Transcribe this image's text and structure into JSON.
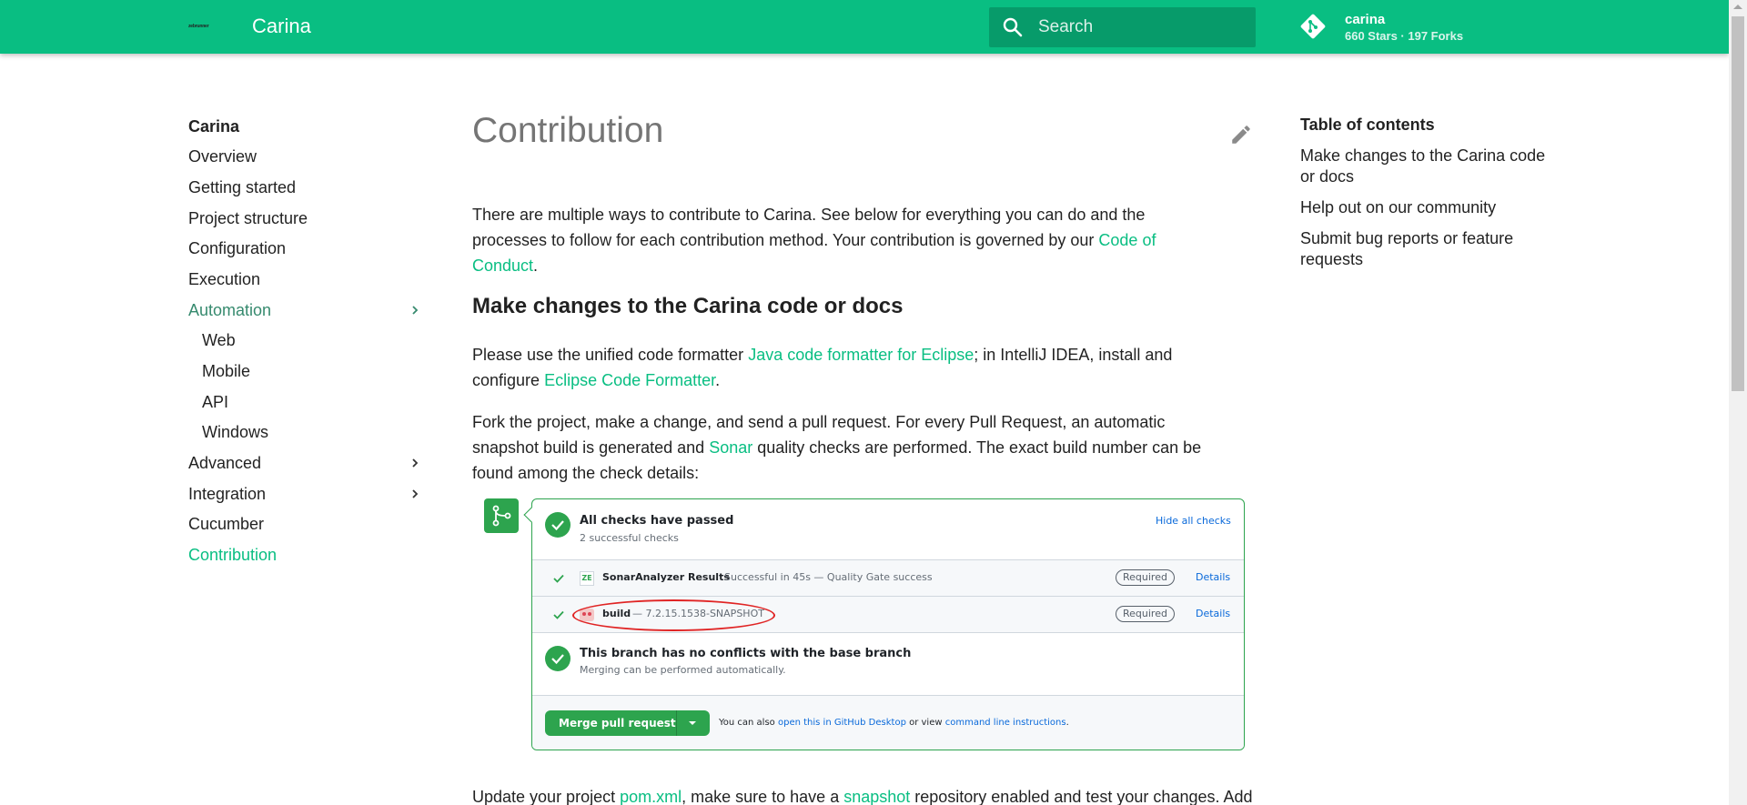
{
  "header": {
    "logo_text": "zebrunner",
    "site_title": "Carina",
    "search_placeholder": "Search",
    "repo_name": "carina",
    "repo_stats": "660 Stars · 197 Forks"
  },
  "nav": {
    "title": "Carina",
    "items": [
      {
        "label": "Overview"
      },
      {
        "label": "Getting started"
      },
      {
        "label": "Project structure"
      },
      {
        "label": "Configuration"
      },
      {
        "label": "Execution"
      },
      {
        "label": "Automation"
      },
      {
        "label": "Web"
      },
      {
        "label": "Mobile"
      },
      {
        "label": "API"
      },
      {
        "label": "Windows"
      },
      {
        "label": "Advanced"
      },
      {
        "label": "Integration"
      },
      {
        "label": "Cucumber"
      },
      {
        "label": "Contribution"
      }
    ]
  },
  "main": {
    "title": "Contribution",
    "intro": {
      "text": "There are multiple ways to contribute to Carina. See below for everything you can do and the processes to follow for each contribution method. Your contribution is governed by our ",
      "link": "Code of Conduct",
      "end": "."
    },
    "h2": "Make changes to the Carina code or docs",
    "p1": {
      "a": "Please use the unified code formatter ",
      "link1": "Java code formatter for Eclipse",
      "b": "; in IntelliJ IDEA, install and configure ",
      "link2": "Eclipse Code Formatter",
      "c": "."
    },
    "p2": {
      "a": "Fork the project, make a change, and send a pull request. For every Pull Request, an automatic snapshot build is generated and ",
      "link": "Sonar",
      "b": " quality checks are performed. The exact build number can be found among the check details:"
    },
    "p3": {
      "a": "Update your project ",
      "link1": "pom.xml",
      "b": ", make sure to have a ",
      "link2": "snapshot",
      "c": " repository enabled and test your changes. Add"
    }
  },
  "checks": {
    "all_passed_title": "All checks have passed",
    "all_passed_sub": "2 successful checks",
    "hide_link": "Hide all checks",
    "rows": [
      {
        "name": "SonarAnalyzer Results",
        "desc": "Successful in 45s — Quality Gate success",
        "badge": "Required",
        "details": "Details",
        "app_text": "ZE"
      },
      {
        "name": "build",
        "desc": "— 7.2.15.1538-SNAPSHOT",
        "badge": "Required",
        "details": "Details"
      }
    ],
    "no_conflicts_title": "This branch has no conflicts with the base branch",
    "no_conflicts_sub": "Merging can be performed automatically.",
    "merge_button": "Merge pull request",
    "footer": {
      "a": "You can also ",
      "link1": "open this in GitHub Desktop",
      "b": " or view ",
      "link2": "command line instructions",
      "c": "."
    }
  },
  "toc": {
    "title": "Table of contents",
    "items": [
      {
        "label": "Make changes to the Carina code or docs"
      },
      {
        "label": "Help out on our community"
      },
      {
        "label": "Submit bug reports or feature requests"
      }
    ]
  },
  "colors": {
    "primary": "#09be82",
    "github_green": "#2da44e",
    "link_blue": "#0969da",
    "highlight_red": "#e02424"
  }
}
